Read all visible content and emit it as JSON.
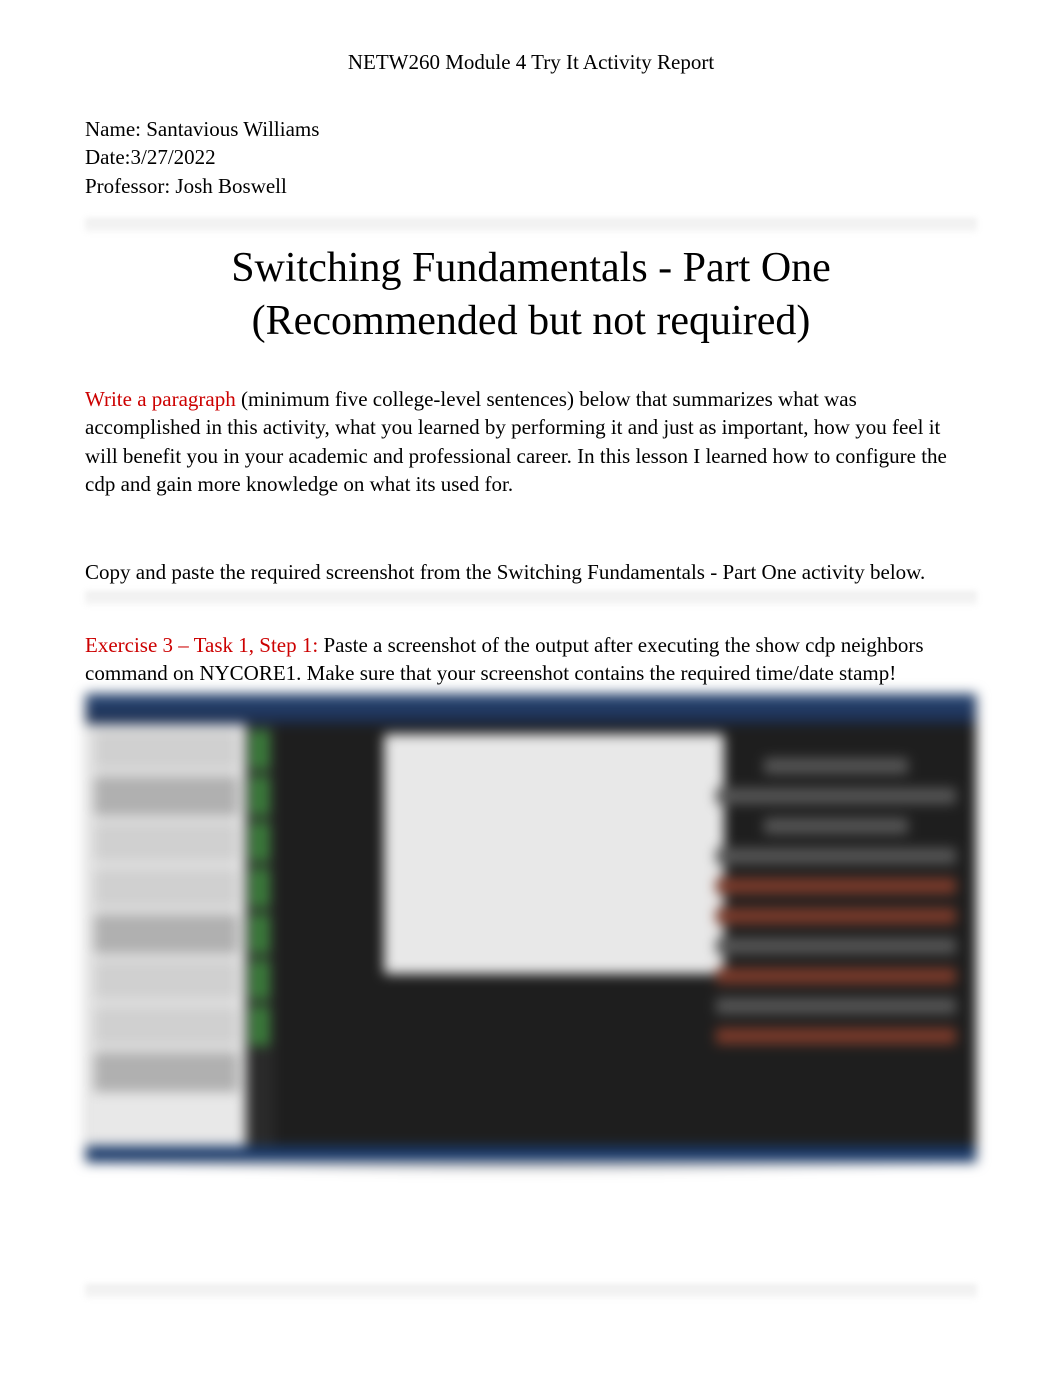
{
  "header": {
    "title": "NETW260 Module 4 Try It Activity Report"
  },
  "meta": {
    "name_label": "Name: ",
    "name_value": "Santavious Williams",
    "date_label": "Date:",
    "date_value": "3/27/2022",
    "professor_label": "Professor: ",
    "professor_value": "Josh Boswell"
  },
  "title": {
    "line1": "Switching Fundamentals - Part One",
    "line2": "(Recommended but not required)"
  },
  "paragraph": {
    "red_label": "Write a paragraph",
    "body": " (minimum five college-level sentences) below that summarizes what was accomplished in this activity, what you learned by performing it and just as important, how you feel it will benefit you in your academic and professional career. In this lesson I learned how to configure the cdp and gain more knowledge on what its used for."
  },
  "instruction": {
    "pre": "Copy and paste the required screenshot from the ",
    "activity": "Switching Fundamentals - Part One",
    "post": " activity below."
  },
  "exercise": {
    "red_label": "Exercise 3 – Task 1, Step 1:",
    "body_pre": " Paste a screenshot of the output after executing the ",
    "command": "show cdp neighbors",
    "body_mid": " command on ",
    "device": "NYCORE1",
    "body_post": ". Make sure that your screenshot contains the required time/date stamp!"
  }
}
